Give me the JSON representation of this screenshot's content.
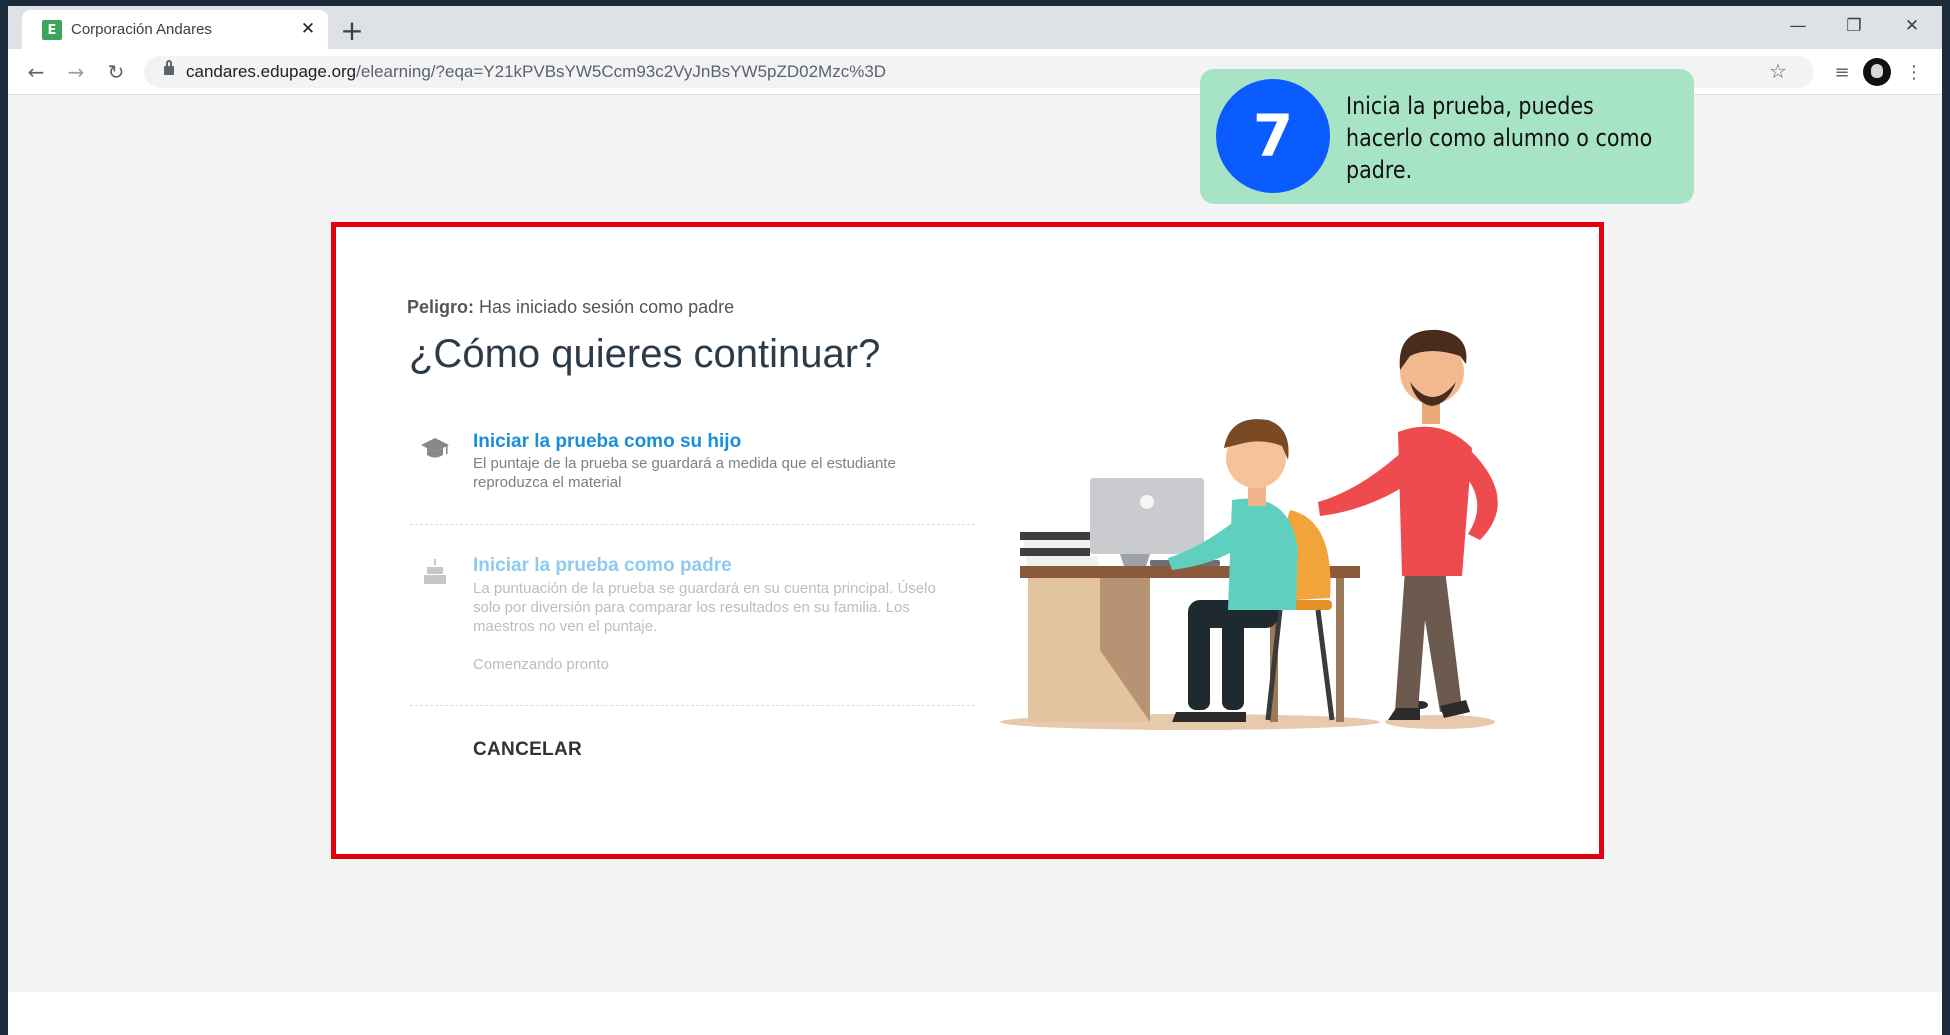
{
  "browser": {
    "tab_title": "Corporación Andares",
    "favicon_letter": "E",
    "new_tab_glyph": "+",
    "url_host": "candares.edupage.org",
    "url_path": "/elearning/?eqa=Y21kPVBsYW5Ccm93c2VyJnBsYW5pZD02Mzc%3D"
  },
  "dialog": {
    "warning_label": "Peligro:",
    "warning_text": "Has iniciado sesión como padre",
    "heading": "¿Cómo quieres continuar?",
    "options": [
      {
        "title": "Iniciar la prueba como su hijo",
        "description": "El puntaje de la prueba se guardará a medida que el estudiante reproduzca el material",
        "icon": "graduation-cap-icon",
        "enabled": true
      },
      {
        "title": "Iniciar la prueba como padre",
        "description": "La puntuación de la prueba se guardará en su cuenta principal. Úselo solo por diversión para comparar los resultados en su familia. Los maestros no ven el puntaje.",
        "note": "Comenzando pronto",
        "icon": "cake-icon",
        "enabled": false
      }
    ],
    "cancel_label": "CANCELAR",
    "highlight_color": "#e3000f"
  },
  "callout": {
    "step_number": "7",
    "text": "Inicia la prueba, puedes hacerlo como alumno o como padre.",
    "bg_color": "#a7e3c5",
    "circle_color": "#0a5cff"
  }
}
